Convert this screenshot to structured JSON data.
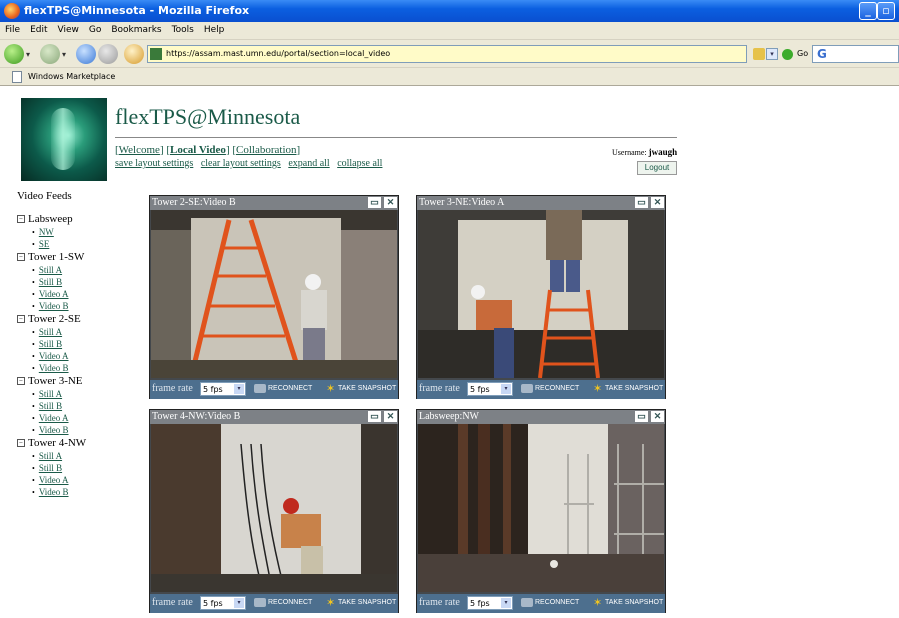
{
  "window": {
    "title": "flexTPS@Minnesota - Mozilla Firefox"
  },
  "menu": [
    "File",
    "Edit",
    "View",
    "Go",
    "Bookmarks",
    "Tools",
    "Help"
  ],
  "nav": {
    "url": "https://assam.mast.umn.edu/portal/section=local_video",
    "go_label": "Go",
    "search_placeholder": "G"
  },
  "bookmarks": [
    "Windows Marketplace"
  ],
  "page": {
    "site_title": "flexTPS@Minnesota",
    "top_links": {
      "welcome": "Welcome",
      "local_video": "Local Video",
      "collaboration": "Collaboration"
    },
    "layout_links": [
      "save layout settings",
      "clear layout settings",
      "expand all",
      "collapse all"
    ],
    "username_label": "Username:",
    "username": "jwaugh",
    "logout": "Logout"
  },
  "sidebar": {
    "title": "Video Feeds",
    "groups": [
      {
        "label": "Labsweep",
        "feeds": [
          "NW",
          "SE"
        ]
      },
      {
        "label": "Tower 1-SW",
        "feeds": [
          "Still A",
          "Still B",
          "Video A",
          "Video B"
        ]
      },
      {
        "label": "Tower 2-SE",
        "feeds": [
          "Still A",
          "Still B",
          "Video A",
          "Video B"
        ]
      },
      {
        "label": "Tower 3-NE",
        "feeds": [
          "Still A",
          "Still B",
          "Video A",
          "Video B"
        ]
      },
      {
        "label": "Tower 4-NW",
        "feeds": [
          "Still A",
          "Still B",
          "Video A",
          "Video B"
        ]
      }
    ]
  },
  "panels": [
    {
      "title": "Tower 2-SE:Video B",
      "frame_rate_label": "frame rate",
      "frame_rate": "5 fps",
      "reconnect": "RECONNECT",
      "snapshot": "TAKE SNAPSHOT"
    },
    {
      "title": "Tower 3-NE:Video A",
      "frame_rate_label": "frame rate",
      "frame_rate": "5 fps",
      "reconnect": "RECONNECT",
      "snapshot": "TAKE SNAPSHOT"
    },
    {
      "title": "Tower 4-NW:Video B",
      "frame_rate_label": "frame rate",
      "frame_rate": "5 fps",
      "reconnect": "RECONNECT",
      "snapshot": "TAKE SNAPSHOT"
    },
    {
      "title": "Labsweep:NW",
      "frame_rate_label": "frame rate",
      "frame_rate": "5 fps",
      "reconnect": "RECONNECT",
      "snapshot": "TAKE SNAPSHOT"
    }
  ],
  "colors": {
    "title_bar": "#0b5fe0",
    "link": "#1a5a48",
    "panel_header": "#7d8186",
    "panel_footer": "#4d6f8e"
  }
}
